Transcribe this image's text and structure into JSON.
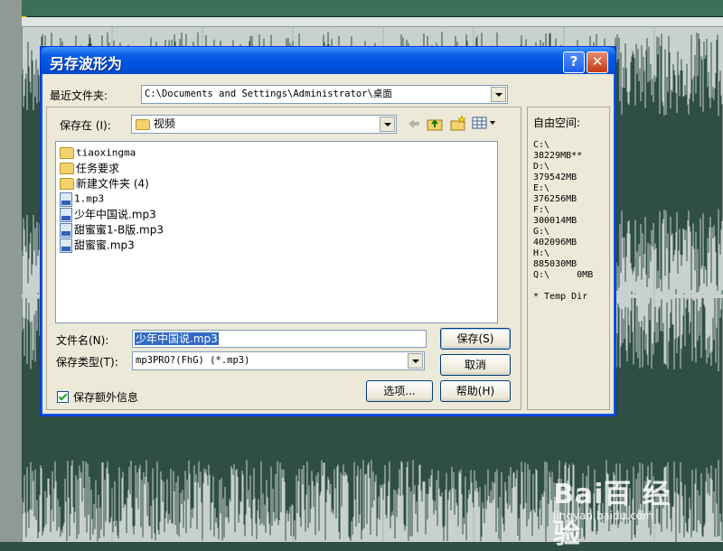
{
  "dialog": {
    "title": "另存波形为",
    "help_glyph": "?",
    "close_glyph": "✕",
    "recent_label": "最近文件夹:",
    "recent_path": "C:\\Documents and Settings\\Administrator\\桌面",
    "save_in_label": "保存在 (I):",
    "save_in_value": "视频",
    "files": [
      {
        "name": "tiaoxingma",
        "type": "folder"
      },
      {
        "name": "任务要求",
        "type": "folder"
      },
      {
        "name": "新建文件夹 (4)",
        "type": "folder"
      },
      {
        "name": "1.mp3",
        "type": "mp3"
      },
      {
        "name": "少年中国说.mp3",
        "type": "mp3"
      },
      {
        "name": "甜蜜蜜1-B版.mp3",
        "type": "mp3"
      },
      {
        "name": "甜蜜蜜.mp3",
        "type": "mp3"
      }
    ],
    "filename_label": "文件名(N):",
    "filename_value": "少年中国说.mp3",
    "filetype_label": "保存类型(T):",
    "filetype_value": "mp3PRO?(FhG) (*.mp3)",
    "save_button": "保存(S)",
    "cancel_button": "取消",
    "options_button": "选项...",
    "help_button": "帮助(H)",
    "extra_info_label": "保存额外信息",
    "extra_info_checked": true,
    "free_space": {
      "title": "自由空间:",
      "lines": [
        "C:\\",
        "38229MB**",
        "D:\\",
        "379542MB",
        "E:\\",
        "376256MB",
        "F:\\",
        "300014MB",
        "G:\\",
        "402096MB",
        "H:\\",
        "885030MB",
        "Q:\\     0MB",
        "",
        "* Temp Dir"
      ]
    }
  },
  "watermark": {
    "logo": "Bai百 经验",
    "url": "jingyan.baidu.com"
  },
  "colors": {
    "titlebar": "#0054e3",
    "dialog_bg": "#ece9d8",
    "waveform": "#2f4f42",
    "selection": "#316ac5"
  },
  "icons": [
    "back-arrow-icon",
    "up-folder-icon",
    "new-folder-icon",
    "view-menu-icon"
  ]
}
